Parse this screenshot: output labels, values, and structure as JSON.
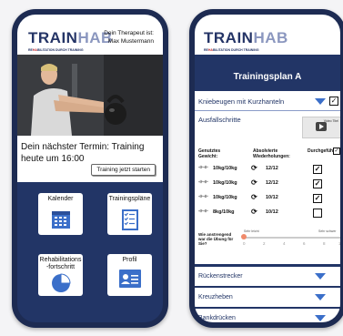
{
  "brand": {
    "part1": "TRAIN",
    "part2": "HAB",
    "sub_prefix": "RE",
    "sub_highlight": "HA",
    "sub_suffix": "BILITATION DURCH TRAINING"
  },
  "home": {
    "therapist_label": "Dein Therapeut ist:",
    "therapist_name": "Max Mustermann",
    "appointment_text": "Dein nächster Termin: Training heute um 16:00",
    "start_button": "Training jetzt starten",
    "tiles": [
      {
        "label": "Kalender",
        "icon": "calendar-icon"
      },
      {
        "label": "Trainingspläne",
        "icon": "checklist-icon"
      },
      {
        "label": "Rehabilitations -fortschritt",
        "icon": "pie-chart-icon"
      },
      {
        "label": "Profil",
        "icon": "profile-card-icon"
      }
    ]
  },
  "plan": {
    "title": "Trainingsplan A",
    "exercise_open": "Kniebeugen mit Kurzhanteln",
    "exercise_open_checked": true,
    "exercise_alt": "Ausfallschritte",
    "video_label": "Video Titel",
    "col_weight": "Genutztes Gewicht:",
    "col_reps": "Absolvierte Wiederholungen:",
    "col_done": "Durchgeführt:",
    "sets": [
      {
        "weight": "10kg/10kg",
        "reps": "12/12",
        "done": true
      },
      {
        "weight": "10kg/10kg",
        "reps": "12/12",
        "done": true
      },
      {
        "weight": "10kg/10kg",
        "reps": "10/12",
        "done": true
      },
      {
        "weight": "8kg/10kg",
        "reps": "10/12",
        "done": false
      }
    ],
    "effort_question": "Wie anstrengend war die Übung für Sie?",
    "effort_low": "Sehr leicht",
    "effort_high": "Sehr schwer",
    "effort_scale": [
      "0",
      "2",
      "4",
      "6",
      "8",
      "1"
    ],
    "effort_value": 0,
    "collapsed": [
      "Rückenstrecker",
      "Kreuzheben",
      "Bankdrücken"
    ]
  },
  "colors": {
    "navy": "#223566",
    "accent": "#3b6fc9",
    "brand_red": "#c1272d"
  }
}
